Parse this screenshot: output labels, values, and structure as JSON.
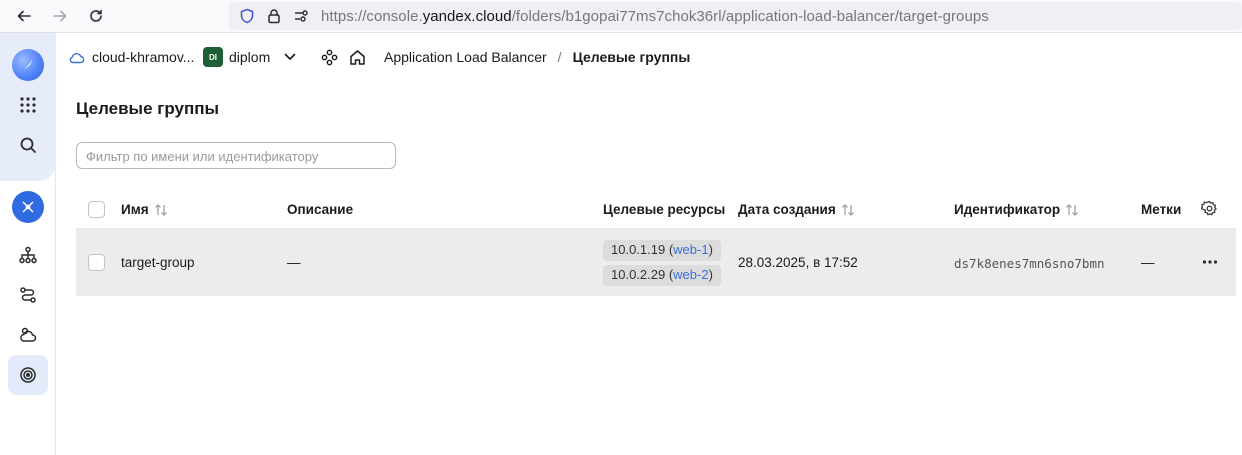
{
  "browser": {
    "url_prefix": "https://console.",
    "url_domain": "yandex.cloud",
    "url_path": "/folders/b1gopai77ms7chok36rl/application-load-balancer/target-groups"
  },
  "rail": {
    "icons": [
      "yandex-cloud-logo-icon",
      "apps-grid-icon",
      "search-icon",
      "alb-service-icon",
      "network-hierarchy-icon",
      "routes-icon",
      "cloud-backends-icon",
      "target-icon"
    ]
  },
  "header": {
    "cloud_name": "cloud-khramov...",
    "folder_badge": "DI",
    "folder_name": "diplom",
    "breadcrumb_service": "Application Load Balancer",
    "breadcrumb_separator": "/",
    "breadcrumb_current": "Целевые группы"
  },
  "page": {
    "title": "Целевые группы",
    "filter_placeholder": "Фильтр по имени или идентификатору"
  },
  "table": {
    "columns": {
      "name": "Имя",
      "description": "Описание",
      "targets": "Целевые ресурсы",
      "created": "Дата создания",
      "id": "Идентификатор",
      "labels": "Метки"
    },
    "rows": [
      {
        "name": "target-group",
        "description": "—",
        "targets": [
          {
            "ip": "10.0.1.19",
            "open": " (",
            "host": "web-1",
            "close": ")"
          },
          {
            "ip": "10.0.2.29",
            "open": " (",
            "host": "web-2",
            "close": ")"
          }
        ],
        "created": "28.03.2025, в 17:52",
        "id": "ds7k8enes7mn6sno7bmn",
        "labels": "—"
      }
    ]
  },
  "colors": {
    "accent": "#2f6ae0",
    "link": "#3a6fd8",
    "row_hover": "#ececec",
    "folder_badge": "#1f5f35"
  }
}
